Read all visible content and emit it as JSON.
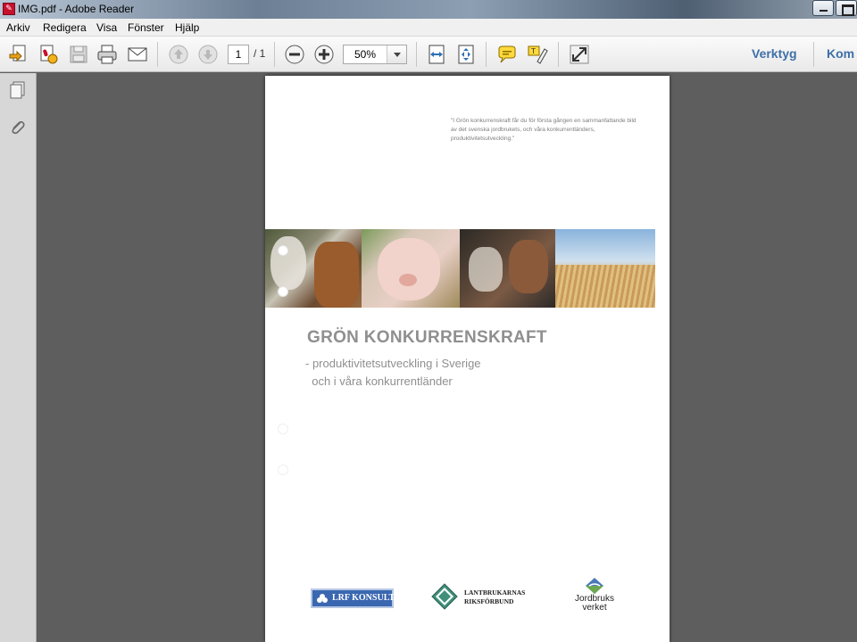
{
  "window": {
    "title": "IMG.pdf - Adobe Reader"
  },
  "menu": [
    "Arkiv",
    "Redigera",
    "Visa",
    "Fönster",
    "Hjälp"
  ],
  "toolbar": {
    "page_current": "1",
    "page_total": "/ 1",
    "zoom": "50%",
    "right_links": [
      "Verktyg",
      "Kom"
    ]
  },
  "document": {
    "quote": "\"I Grön konkurrenskraft får du för första gången en sammanfattande bild av det svenska jordbrukets, och våra konkurrentländers, produktivitetsutveckling.\"",
    "title": "GRÖN KONKURRENSKRAFT",
    "subtitle": "- produktivitetsutveckling i Sverige\n  och i våra konkurrentländer",
    "logos": {
      "lrf": "LRF KONSULT",
      "lantbrukarnas": "LANTBRUKARNAS\nRIKSFÖRBUND",
      "jordbruksverket": "Jordbruks\nverket"
    }
  },
  "icons": [
    "pdf-app-icon",
    "open-file-icon",
    "create-pdf-icon",
    "save-icon",
    "print-icon",
    "email-icon",
    "page-up-icon",
    "page-down-icon",
    "zoom-out-icon",
    "zoom-in-icon",
    "fit-width-icon",
    "fit-page-icon",
    "comment-icon",
    "highlight-icon",
    "fullscreen-icon",
    "pages-panel-icon",
    "attachments-icon"
  ]
}
